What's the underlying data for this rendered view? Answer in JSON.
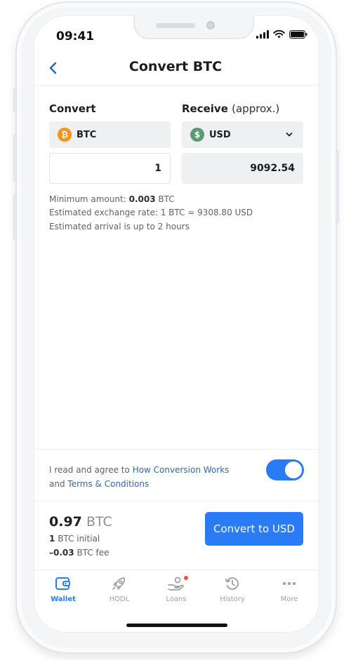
{
  "status_bar": {
    "time": "09:41"
  },
  "nav": {
    "title": "Convert BTC"
  },
  "convert": {
    "label": "Convert",
    "currency": "BTC",
    "currency_icon": "bitcoin-icon",
    "amount": "1"
  },
  "receive": {
    "label": "Receive",
    "label_suffix": "(approx.)",
    "currency": "USD",
    "currency_icon": "dollar-icon",
    "amount": "9092.54"
  },
  "info": {
    "minimum_prefix": "Minimum amount:",
    "minimum_value": "0.003",
    "minimum_unit": "BTC",
    "rate": "Estimated exchange rate: 1 BTC = 9308.80 USD",
    "arrival": "Estimated arrival is up to 2 hours"
  },
  "agreement": {
    "prefix": "I read and agree to",
    "link1": "How Conversion Works",
    "conjunction": "and",
    "link2": "Terms & Conditions",
    "toggle_on": true
  },
  "summary": {
    "total_value": "0.97",
    "total_unit": "BTC",
    "initial_value": "1",
    "initial_label": "BTC initial",
    "fee_value": "–0.03",
    "fee_label": "BTC fee",
    "button": "Convert to USD"
  },
  "tabs": [
    {
      "label": "Wallet",
      "icon": "wallet-icon",
      "active": true
    },
    {
      "label": "HODL",
      "icon": "rocket-icon",
      "active": false
    },
    {
      "label": "Loans",
      "icon": "loans-hand-icon",
      "active": false,
      "badge": true
    },
    {
      "label": "History",
      "icon": "history-clock-icon",
      "active": false
    },
    {
      "label": "More",
      "icon": "more-dots-icon",
      "active": false
    }
  ],
  "colors": {
    "accent": "#2a7cf6",
    "link": "#2d69b6",
    "bitcoin": "#f7931a",
    "dollar": "#5b9a72",
    "badge": "#e5533c"
  }
}
